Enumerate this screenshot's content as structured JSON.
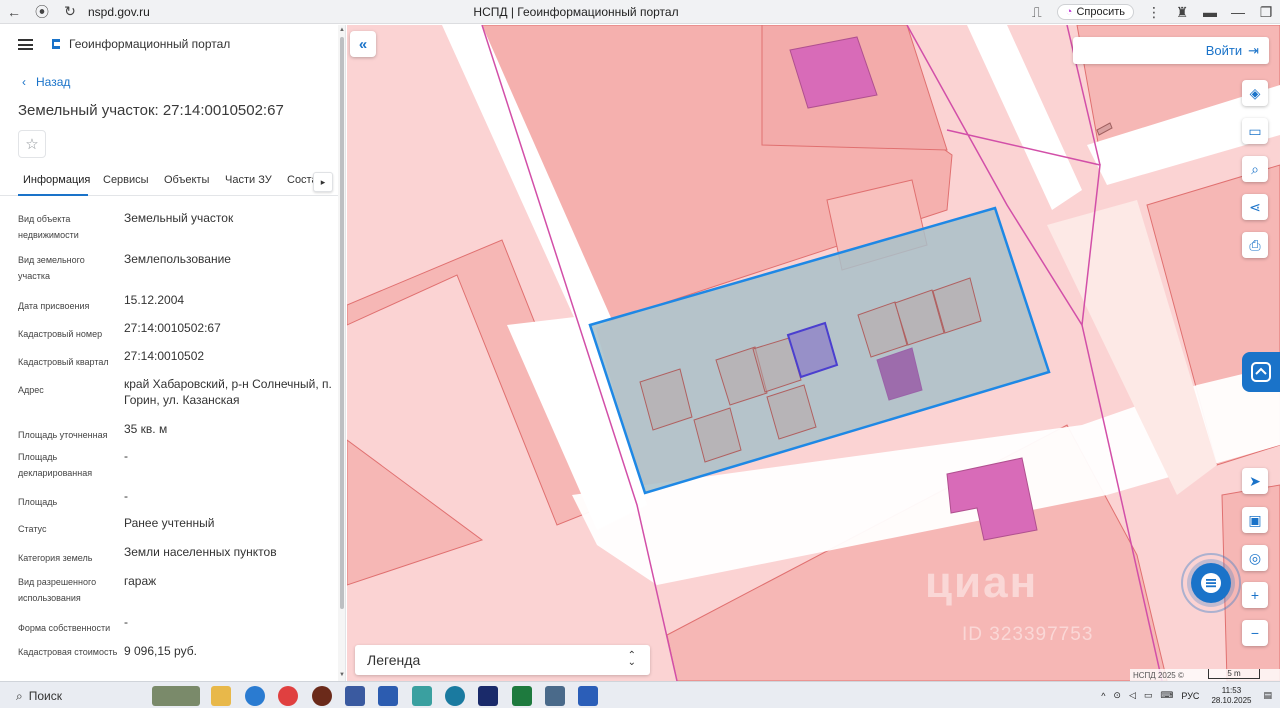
{
  "browser": {
    "url": "nspd.gov.ru",
    "tab_title": "НСПД | Геоинформационный портал",
    "ask_label": "Спросить"
  },
  "sidebar": {
    "portal_title": "Геоинформационный портал",
    "back_label": "Назад",
    "plot_title": "Земельный участок: 27:14:0010502:67",
    "tabs": [
      "Информация",
      "Сервисы",
      "Объекты",
      "Части ЗУ",
      "Состав"
    ],
    "active_tab": "Информация",
    "info": [
      {
        "label": "Вид объекта недвижимости",
        "value": "Земельный участок"
      },
      {
        "label": "Вид земельного участка",
        "value": "Землепользование"
      },
      {
        "label": "Дата присвоения",
        "value": "15.12.2004"
      },
      {
        "label": "Кадастровый номер",
        "value": "27:14:0010502:67"
      },
      {
        "label": "Кадастровый квартал",
        "value": "27:14:0010502"
      },
      {
        "label": "Адрес",
        "value": "край Хабаровский, р-н Солнечный, п. Горин, ул. Казанская"
      },
      {
        "label": "Площадь уточненная",
        "value": "35 кв. м"
      },
      {
        "label": "Площадь декларированная",
        "value": "-"
      },
      {
        "label": "Площадь",
        "value": "-"
      },
      {
        "label": "Статус",
        "value": "Ранее учтенный"
      },
      {
        "label": "Категория земель",
        "value": "Земли населенных пунктов"
      },
      {
        "label": "Вид разрешенного использования",
        "value": "гараж"
      },
      {
        "label": "Форма собственности",
        "value": "-"
      },
      {
        "label": "Кадастровая стоимость",
        "value": "9 096,15 руб."
      }
    ]
  },
  "map": {
    "login_label": "Войти",
    "legend_label": "Легенда",
    "attribution": "НСПД 2025 ©",
    "scale_label": "5 m",
    "watermark": "циан",
    "watermark_id": "ID 323397753",
    "colors": {
      "parcel_fill": "#f6b7b5",
      "parcel_stroke": "#d5505a",
      "boundary": "#d24fa8",
      "selected_stroke": "#1e88e5",
      "building": "#d86bb8",
      "accent": "#1a73c9"
    }
  },
  "taskbar": {
    "search_label": "Поиск",
    "lang": "РУС",
    "time": "11:53",
    "date": "28.10.2025"
  }
}
